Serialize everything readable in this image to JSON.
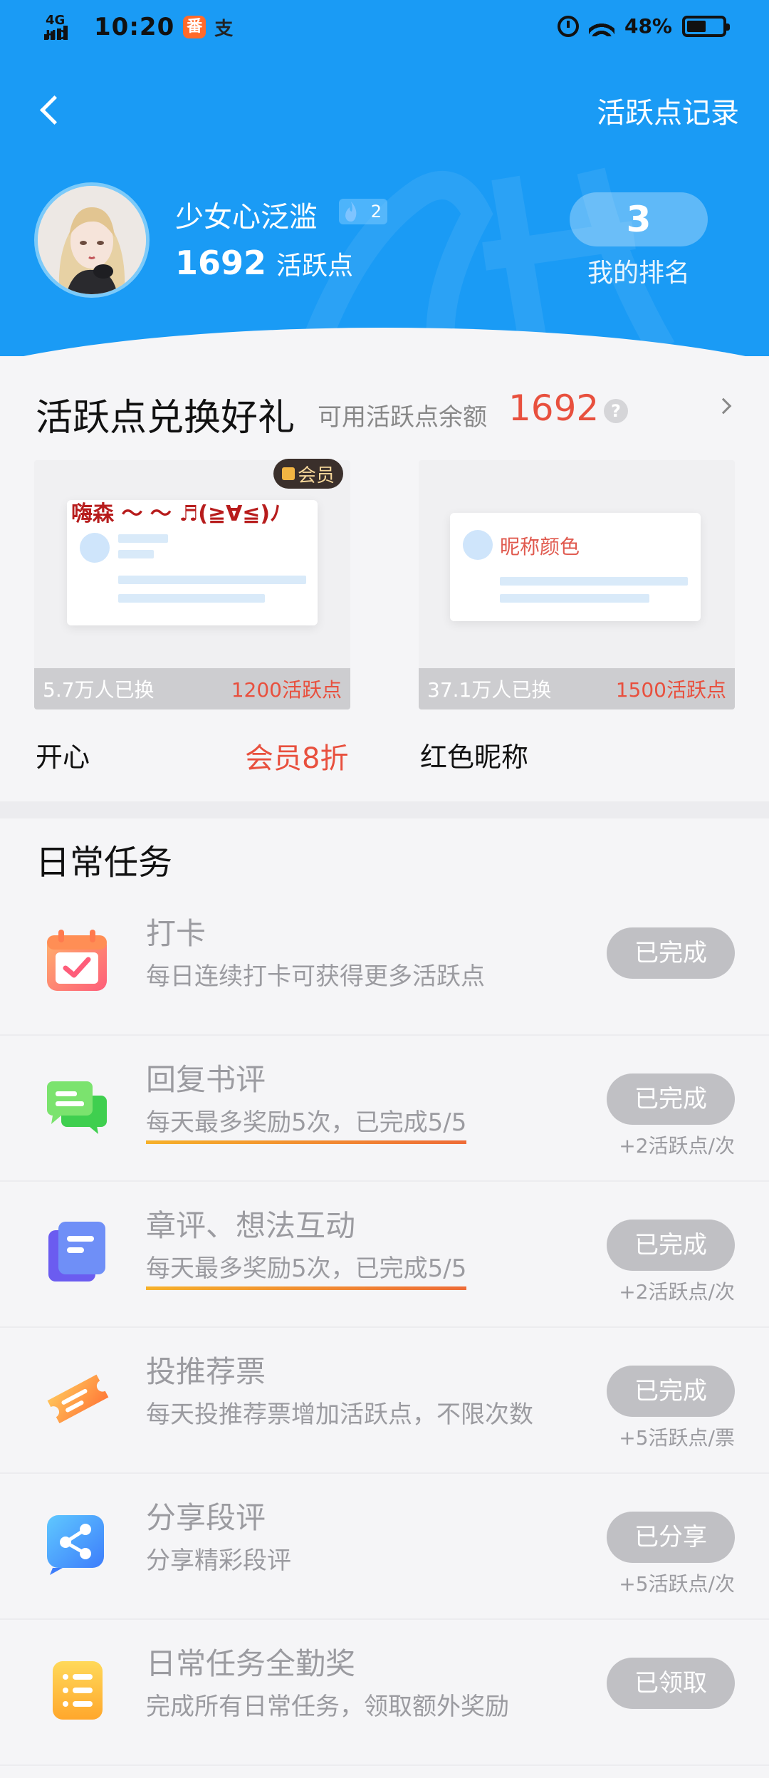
{
  "status_bar": {
    "network": "4G HD",
    "time": "10:20",
    "app1": "番",
    "app2": "支",
    "battery": "48%"
  },
  "nav": {
    "record_label": "活跃点记录"
  },
  "profile": {
    "username": "少女心泛滥",
    "level": "2",
    "points": "1692",
    "points_unit": "活跃点",
    "rank": "3",
    "rank_label": "我的排名"
  },
  "exchange": {
    "title": "活跃点兑换好礼",
    "balance_label": "可用活跃点余额",
    "balance": "1692",
    "help": "?",
    "gifts": [
      {
        "name": "开心",
        "tag": "会员",
        "preview_text": "嗨森 ～ ～ ♬(≧∀≦)ﾉ",
        "count": "5.7万人已换",
        "cost": "1200活跃点",
        "discount": "会员8折"
      },
      {
        "name": "红色昵称",
        "preview_text": "昵称颜色",
        "count": "37.1万人已换",
        "cost": "1500活跃点"
      }
    ]
  },
  "tasks": {
    "title": "日常任务",
    "items": [
      {
        "icon": "calendar-check-icon",
        "name": "打卡",
        "desc": "每日连续打卡可获得更多活跃点",
        "button": "已完成",
        "reward": ""
      },
      {
        "icon": "chat-bubbles-icon",
        "name": "回复书评",
        "desc": "每天最多奖励5次，已完成5/5",
        "button": "已完成",
        "reward": "+2活跃点/次"
      },
      {
        "icon": "notes-icon",
        "name": "章评、想法互动",
        "desc": "每天最多奖励5次，已完成5/5",
        "button": "已完成",
        "reward": "+2活跃点/次"
      },
      {
        "icon": "ticket-icon",
        "name": "投推荐票",
        "desc": "每天投推荐票增加活跃点，不限次数",
        "button": "已完成",
        "reward": "+5活跃点/票"
      },
      {
        "icon": "share-icon",
        "name": "分享段评",
        "desc": "分享精彩段评",
        "button": "已分享",
        "reward": "+5活跃点/次"
      },
      {
        "icon": "list-icon",
        "name": "日常任务全勤奖",
        "desc": "完成所有日常任务，领取额外奖励",
        "button": "已领取",
        "reward": ""
      }
    ]
  },
  "colors": {
    "header_blue": "#1a9bf5",
    "accent_red": "#e8503e",
    "button_gray": "#c0c0c4",
    "progress_underline": "#f39a2f"
  }
}
